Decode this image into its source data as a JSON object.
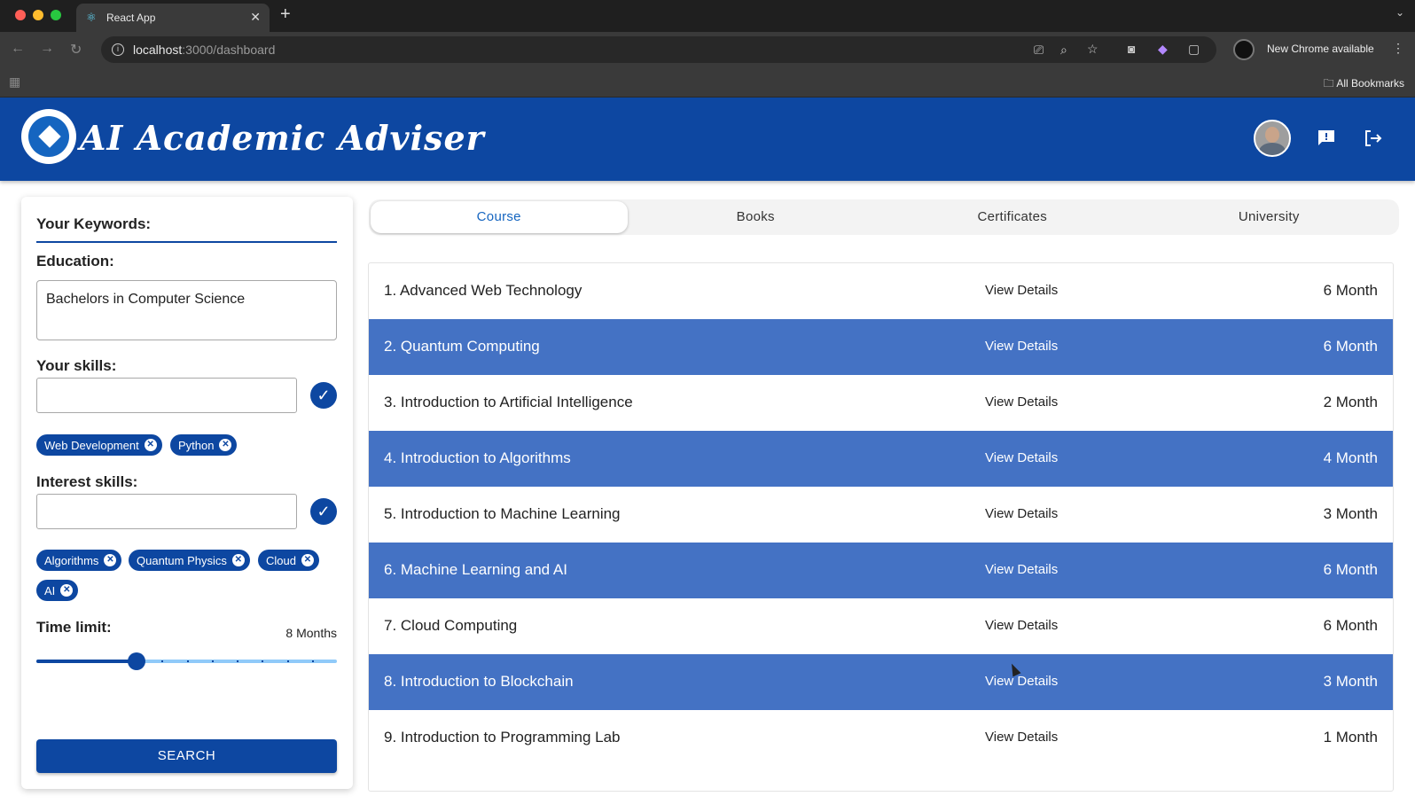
{
  "browser": {
    "tab_title": "React App",
    "url_host": "localhost",
    "url_rest": ":3000/dashboard",
    "update_label": "New Chrome available",
    "bookmarks_label": "All Bookmarks"
  },
  "header": {
    "app_title": "AI Academic Adviser",
    "brand_color": "#0d47a1"
  },
  "filters": {
    "heading": "Your Keywords:",
    "education_label": "Education:",
    "education_value": "Bachelors in Computer Science",
    "skills_label": "Your skills:",
    "skills_input_value": "",
    "skills": [
      "Web Development",
      "Python"
    ],
    "interest_label": "Interest skills:",
    "interest_input_value": "",
    "interests": [
      "Algorithms",
      "Quantum Physics",
      "Cloud",
      "AI"
    ],
    "time_label": "Time limit:",
    "time_value": "8 Months",
    "time_slider": {
      "value": 8,
      "max": 24,
      "steps": 12
    },
    "search_label": "SEARCH"
  },
  "tabs": [
    {
      "label": "Course",
      "active": true
    },
    {
      "label": "Books",
      "active": false
    },
    {
      "label": "Certificates",
      "active": false
    },
    {
      "label": "University",
      "active": false
    }
  ],
  "courses": [
    {
      "name": "1. Advanced Web Technology",
      "action": "View Details",
      "duration": "6 Month"
    },
    {
      "name": "2. Quantum Computing",
      "action": "View Details",
      "duration": "6 Month"
    },
    {
      "name": "3. Introduction to Artificial Intelligence",
      "action": "View Details",
      "duration": "2 Month"
    },
    {
      "name": "4. Introduction to Algorithms",
      "action": "View Details",
      "duration": "4 Month"
    },
    {
      "name": "5. Introduction to Machine Learning",
      "action": "View Details",
      "duration": "3 Month"
    },
    {
      "name": "6. Machine Learning and AI",
      "action": "View Details",
      "duration": "6 Month"
    },
    {
      "name": "7. Cloud Computing",
      "action": "View Details",
      "duration": "6 Month"
    },
    {
      "name": "8. Introduction to Blockchain",
      "action": "View Details",
      "duration": "3 Month"
    },
    {
      "name": "9. Introduction to Programming Lab",
      "action": "View Details",
      "duration": "1 Month"
    }
  ]
}
